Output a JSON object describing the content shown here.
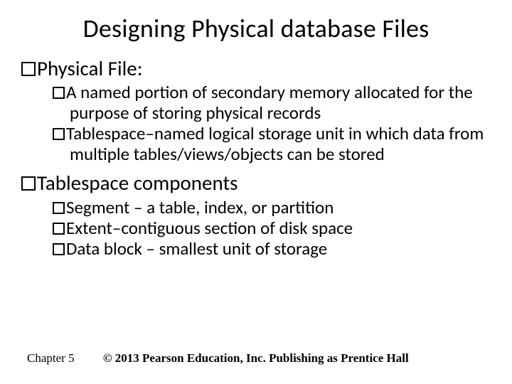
{
  "title": "Designing Physical database Files",
  "sections": [
    {
      "heading": "Physical File:",
      "items": [
        "A named portion of secondary memory allocated for the purpose of storing physical records",
        "Tablespace–named logical storage unit in which data from multiple tables/views/objects can be stored"
      ]
    },
    {
      "heading": "Tablespace components",
      "items": [
        "Segment – a table, index, or partition",
        "Extent–contiguous section of disk space",
        "Data block – smallest unit of storage"
      ]
    }
  ],
  "footer": {
    "chapter": "Chapter 5",
    "copyright": "© 2013 Pearson Education, Inc.  Publishing as Prentice Hall"
  }
}
